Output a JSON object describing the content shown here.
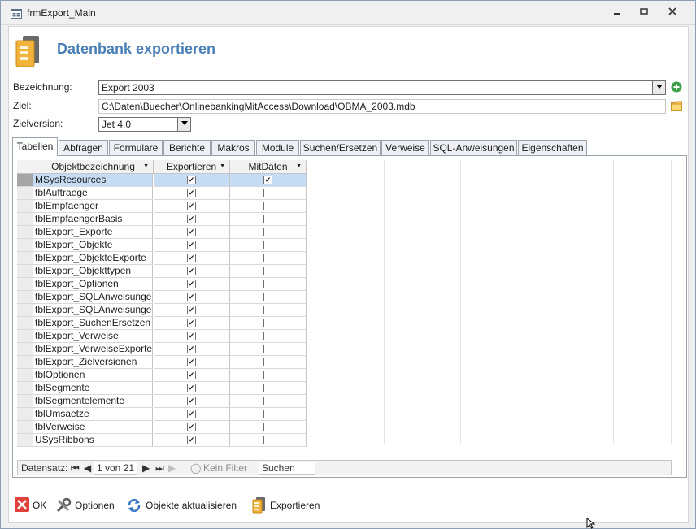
{
  "window": {
    "title": "frmExport_Main"
  },
  "header": {
    "title": "Datenbank exportieren"
  },
  "form": {
    "bezeichnung_label": "Bezeichnung:",
    "bezeichnung_value": "Export 2003",
    "ziel_label": "Ziel:",
    "ziel_value": "C:\\Daten\\Buecher\\OnlinebankingMitAccess\\Download\\OBMA_2003.mdb",
    "zielversion_label": "Zielversion:",
    "zielversion_value": "Jet 4.0"
  },
  "tabs": [
    "Tabellen",
    "Abfragen",
    "Formulare",
    "Berichte",
    "Makros",
    "Module",
    "Suchen/Ersetzen",
    "Verweise",
    "SQL-Anweisungen",
    "Eigenschaften"
  ],
  "grid": {
    "columns": [
      "Objektbezeichnung",
      "Exportieren",
      "MitDaten"
    ],
    "rows": [
      {
        "name": "MSysResources",
        "export": true,
        "mitdaten": true
      },
      {
        "name": "tblAuftraege",
        "export": true,
        "mitdaten": false
      },
      {
        "name": "tblEmpfaenger",
        "export": true,
        "mitdaten": false
      },
      {
        "name": "tblEmpfaengerBasis",
        "export": true,
        "mitdaten": false
      },
      {
        "name": "tblExport_Exporte",
        "export": true,
        "mitdaten": false
      },
      {
        "name": "tblExport_Objekte",
        "export": true,
        "mitdaten": false
      },
      {
        "name": "tblExport_ObjekteExporte",
        "export": true,
        "mitdaten": false
      },
      {
        "name": "tblExport_Objekttypen",
        "export": true,
        "mitdaten": false
      },
      {
        "name": "tblExport_Optionen",
        "export": true,
        "mitdaten": false
      },
      {
        "name": "tblExport_SQLAnweisungen",
        "export": true,
        "mitdaten": false
      },
      {
        "name": "tblExport_SQLAnweisungenE",
        "export": true,
        "mitdaten": false
      },
      {
        "name": "tblExport_SuchenErsetzen",
        "export": true,
        "mitdaten": false
      },
      {
        "name": "tblExport_Verweise",
        "export": true,
        "mitdaten": false
      },
      {
        "name": "tblExport_VerweiseExporte",
        "export": true,
        "mitdaten": false
      },
      {
        "name": "tblExport_Zielversionen",
        "export": true,
        "mitdaten": false
      },
      {
        "name": "tblOptionen",
        "export": true,
        "mitdaten": false
      },
      {
        "name": "tblSegmente",
        "export": true,
        "mitdaten": false
      },
      {
        "name": "tblSegmentelemente",
        "export": true,
        "mitdaten": false
      },
      {
        "name": "tblUmsaetze",
        "export": true,
        "mitdaten": false
      },
      {
        "name": "tblVerweise",
        "export": true,
        "mitdaten": false
      },
      {
        "name": "USysRibbons",
        "export": true,
        "mitdaten": false
      }
    ]
  },
  "navigation": {
    "label": "Datensatz:",
    "position": "1 von 21",
    "filter_label": "Kein Filter",
    "search_value": "Suchen"
  },
  "buttons": {
    "ok": "OK",
    "optionen": "Optionen",
    "aktualisieren": "Objekte aktualisieren",
    "exportieren": "Exportieren"
  },
  "icons": {
    "window": "form-icon",
    "header": "database-export-icon",
    "add": "plus-icon",
    "browse": "folder-icon",
    "ok": "close-x-icon",
    "optionen": "tools-icon",
    "aktualisieren": "refresh-icon",
    "exportieren": "export-icon"
  },
  "colors": {
    "title": "#4a7fb6",
    "selection": "#c6dcf4",
    "ok_red": "#e0403a",
    "add_green": "#3ca14a"
  }
}
